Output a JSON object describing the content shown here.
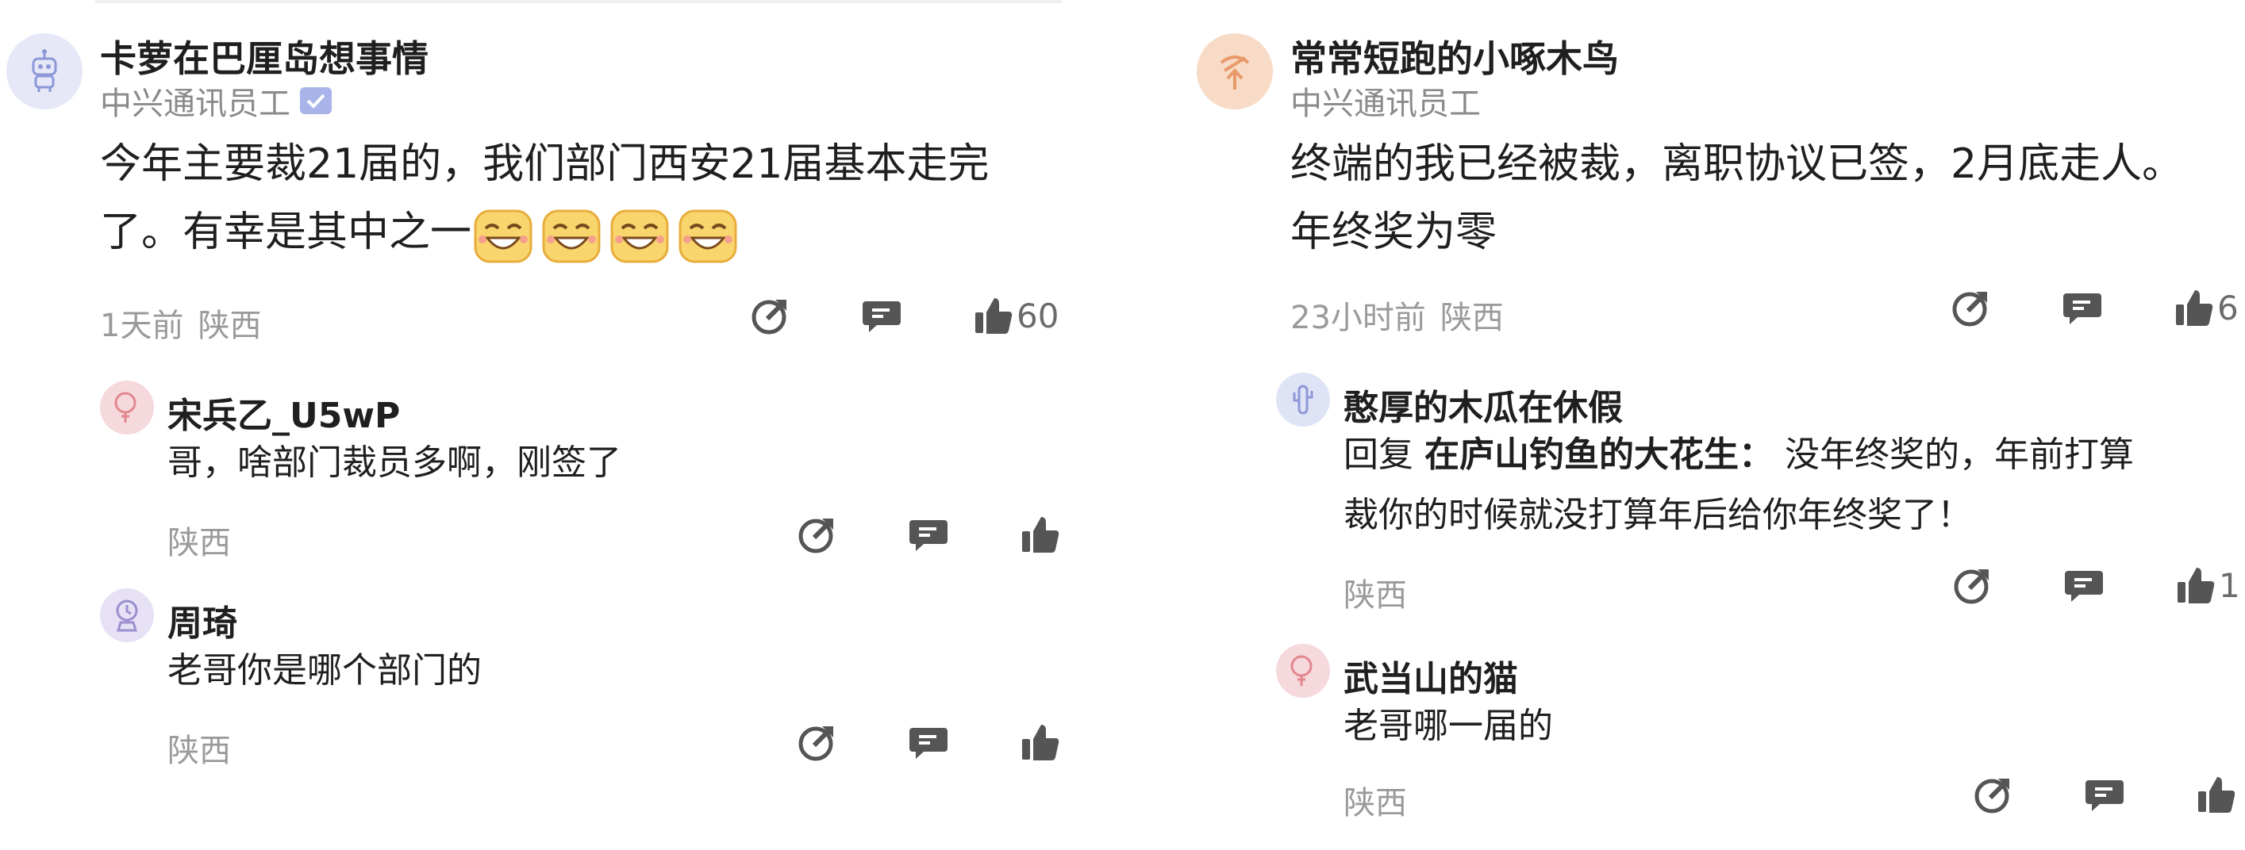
{
  "left": {
    "main": {
      "author": "卡萝在巴厘岛想事情",
      "subtitle": "中兴通讯员工",
      "text_line1": "今年主要裁21届的，我们部门西安21届基本走完",
      "text_line2": "了。有幸是其中之一",
      "time": "1天前",
      "location": "陕西",
      "likes": "60"
    },
    "replies": [
      {
        "author": "宋兵乙_U5wP",
        "text": "哥，啥部门裁员多啊，刚签了",
        "location": "陕西"
      },
      {
        "author": "周琦",
        "text": "老哥你是哪个部门的",
        "location": "陕西"
      }
    ]
  },
  "right": {
    "main": {
      "author": "常常短跑的小啄木鸟",
      "subtitle": "中兴通讯员工",
      "text_line1": "终端的我已经被裁，离职协议已签，2月底走人。",
      "text_line2": "年终奖为零",
      "time": "23小时前",
      "location": "陕西",
      "likes": "6"
    },
    "replies": [
      {
        "author": "憨厚的木瓜在休假",
        "reply_prefix": "回复",
        "reply_to": "在庐山钓鱼的大花生：",
        "text_line1": "没年终奖的，年前打算",
        "text_line2": "裁你的时候就没打算年后给你年终奖了！",
        "location": "陕西",
        "likes": "1"
      },
      {
        "author": "武当山的猫",
        "text": "老哥哪一届的",
        "location": "陕西"
      }
    ]
  },
  "icons": {
    "share": "share-icon",
    "comment": "comment-icon",
    "like": "like-icon",
    "verified": "verified-badge-icon"
  },
  "colors": {
    "text": "#1f1f1f",
    "meta": "#9a9a9a",
    "icon": "#555555",
    "badge": "#a8b4ea"
  }
}
